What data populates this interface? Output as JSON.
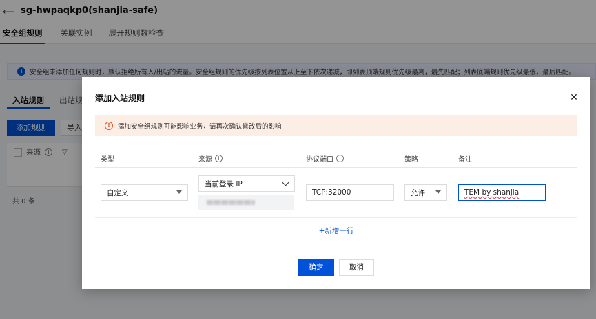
{
  "page": {
    "title": "sg-hwpaqkp0(shanjia-safe)",
    "tabs": [
      "安全组规则",
      "关联实例",
      "展开规则数检查"
    ],
    "info_text": "安全组未添加任何规则时，默认拒绝所有入/出站的流量。安全组规则的优先级按列表位置从上至下依次递减，即列表顶端规则优先级最高，最先匹配；列表底端规则优先级最低，最后匹配。",
    "subtabs": [
      "入站规则",
      "出站规"
    ],
    "add_rule_label": "添加规则",
    "import_label": "导入",
    "table": {
      "col_source": "来源"
    },
    "total_label": "共 0 条"
  },
  "modal": {
    "title": "添加入站规则",
    "warning": "添加安全组规则可能影响业务，请再次确认修改后的影响",
    "columns": {
      "type": "类型",
      "source": "来源",
      "port": "协议端口",
      "policy": "策略",
      "remark": "备注"
    },
    "row": {
      "type_value": "自定义",
      "source_value": "当前登录 IP",
      "port_value": "TCP:32000",
      "policy_value": "允许",
      "remark_value": "TEM by shanjia"
    },
    "add_row_label": "+新增一行",
    "confirm_label": "确定",
    "cancel_label": "取消"
  },
  "colors": {
    "primary": "#0052d9",
    "warning_bg": "#fdeee5",
    "warning_icon": "#d9531e"
  }
}
